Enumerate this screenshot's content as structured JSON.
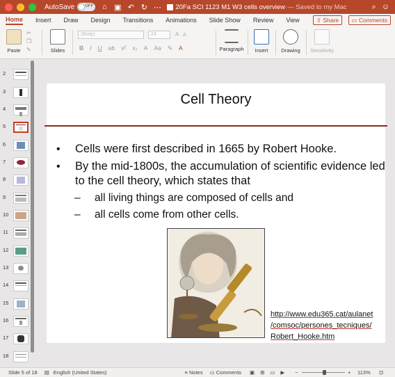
{
  "titlebar": {
    "autosave_label": "AutoSave",
    "autosave_state": "OFF",
    "document_title": "20Fa SCI 1123 M1 W3 cells overview",
    "saved_status": "— Saved to my Mac"
  },
  "tabs": [
    "Home",
    "Insert",
    "Draw",
    "Design",
    "Transitions",
    "Animations",
    "Slide Show",
    "Review",
    "View"
  ],
  "active_tab": "Home",
  "share_label": "Share",
  "comments_label": "Comments",
  "ribbon": {
    "paste_label": "Paste",
    "slides_label": "Slides",
    "font_name_placeholder": "(Body)",
    "font_size_placeholder": "24",
    "bold": "B",
    "italic": "I",
    "underline": "U",
    "paragraph_label": "Paragraph",
    "insert_label": "Insert",
    "drawing_label": "Drawing",
    "sensitivity_label": "Sensitivity"
  },
  "thumbnails": [
    {
      "num": "2"
    },
    {
      "num": "3"
    },
    {
      "num": "4"
    },
    {
      "num": "5",
      "selected": true
    },
    {
      "num": "6"
    },
    {
      "num": "7"
    },
    {
      "num": "8"
    },
    {
      "num": "9"
    },
    {
      "num": "10"
    },
    {
      "num": "11"
    },
    {
      "num": "12"
    },
    {
      "num": "13"
    },
    {
      "num": "14"
    },
    {
      "num": "15"
    },
    {
      "num": "16"
    },
    {
      "num": "17"
    },
    {
      "num": "18"
    }
  ],
  "slide": {
    "title": "Cell Theory",
    "bullet1": "Cells were first described in 1665 by Robert Hooke.",
    "bullet2": "By the mid-1800s, the accumulation of scientific evidence led to the cell theory, which states that",
    "sub1": "all living things are composed of cells and",
    "sub2": "all cells come from other cells.",
    "link_line1": "http://www.edu365.cat/aulanet",
    "link_line2": "/comsoc/persones_tecniques/",
    "link_line3": "Robert_Hooke.htm"
  },
  "statusbar": {
    "slide_info": "Slide 5 of 18",
    "language": "English (United States)",
    "notes_label": "Notes",
    "comments_label": "Comments",
    "zoom": "113%"
  },
  "colors": {
    "accent": "#b7472a",
    "title_rule": "#8a2d20",
    "selected_thumb": "#c43e1c"
  }
}
